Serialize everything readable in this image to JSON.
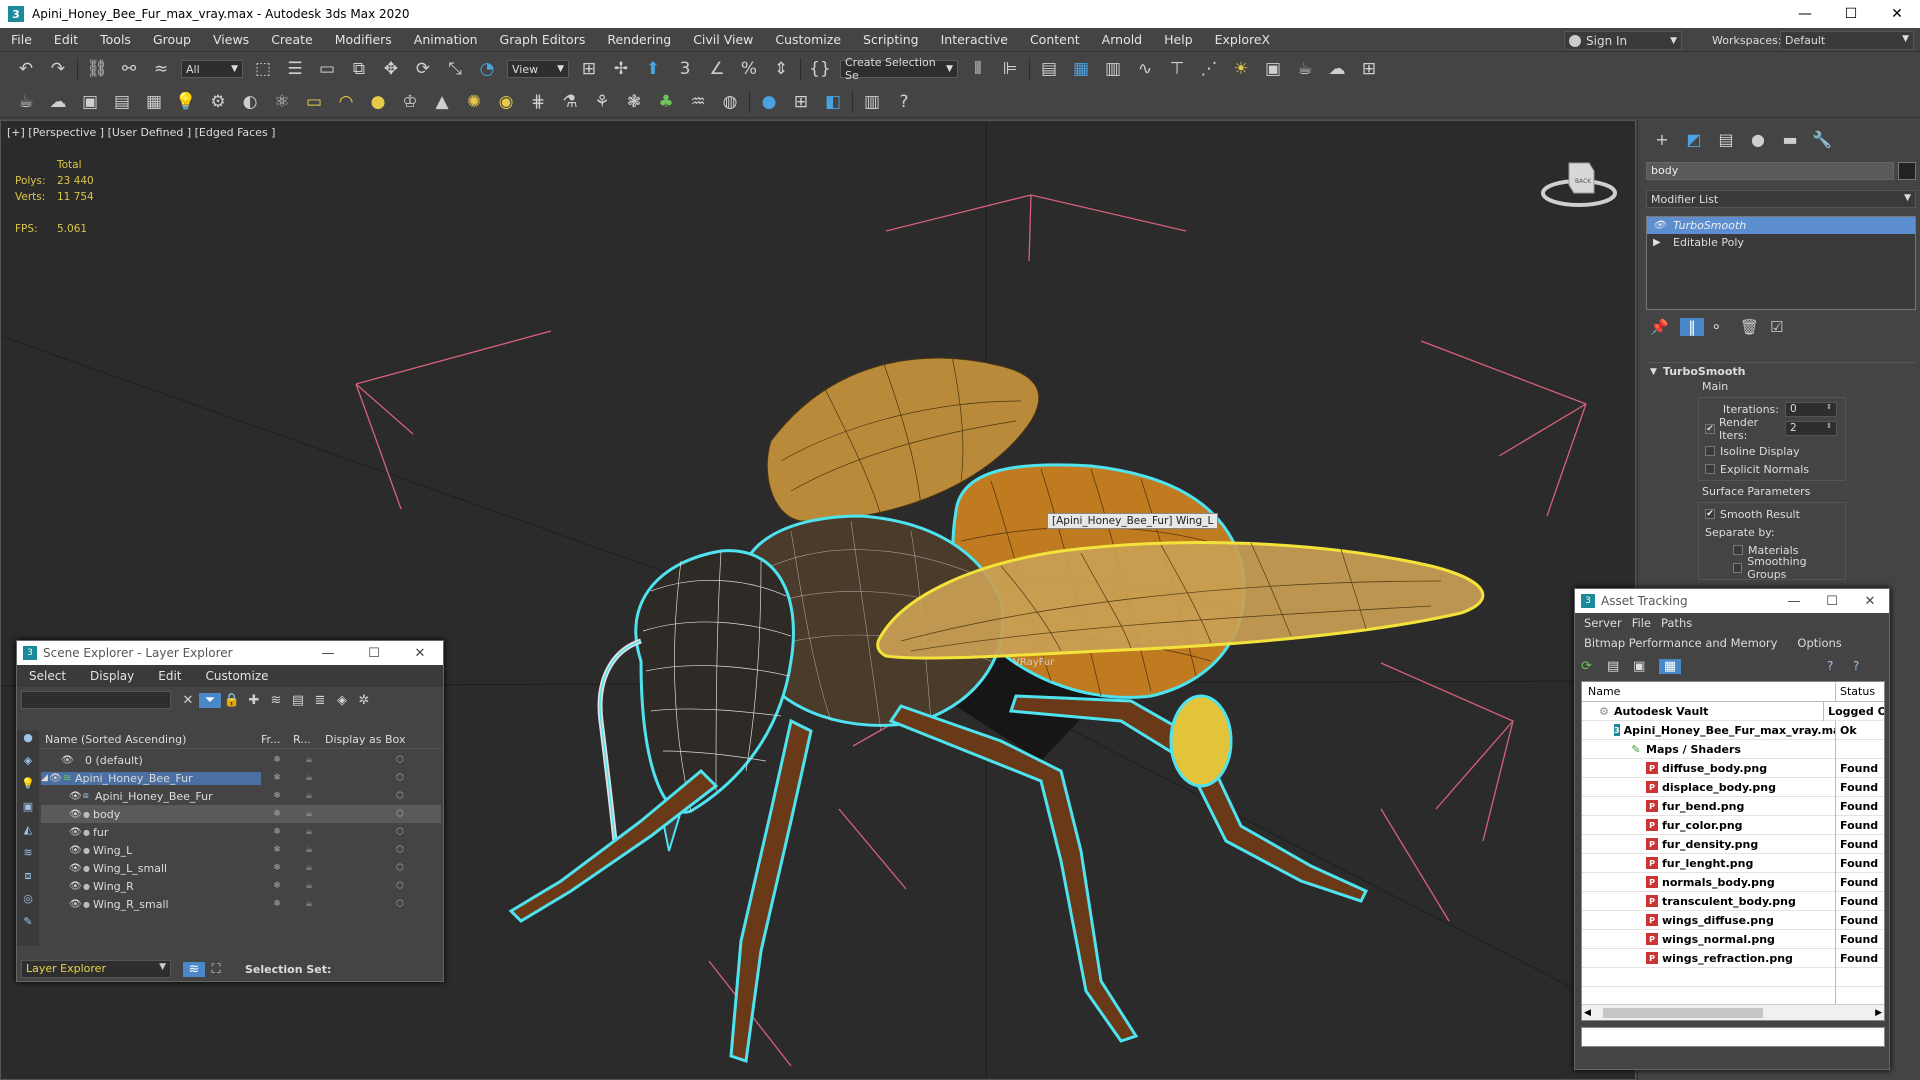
{
  "window": {
    "title": "Apini_Honey_Bee_Fur_max_vray.max - Autodesk 3ds Max 2020",
    "app_icon": "3",
    "minimize": "—",
    "maximize": "☐",
    "close": "✕"
  },
  "menubar": [
    "File",
    "Edit",
    "Tools",
    "Group",
    "Views",
    "Create",
    "Modifiers",
    "Animation",
    "Graph Editors",
    "Rendering",
    "Civil View",
    "Customize",
    "Scripting",
    "Interactive",
    "Content",
    "Arnold",
    "Help",
    "ExploreX"
  ],
  "signin": {
    "label": "Sign In"
  },
  "workspaces": {
    "label": "Workspaces:",
    "value": "Default"
  },
  "toolbar1": {
    "selection_filter": "All",
    "ref_coord": "View",
    "named_selection": "Create Selection Se"
  },
  "viewport": {
    "label": "[+] [Perspective ] [User Defined ] [Edged Faces ]",
    "stats": {
      "total_label": "Total",
      "polys_label": "Polys:",
      "polys_value": "23 440",
      "verts_label": "Verts:",
      "verts_value": "11 754",
      "fps_label": "FPS:",
      "fps_value": "5.061"
    },
    "tooltip": "[Apini_Honey_Bee_Fur] Wing_L",
    "vrayfur_label": "VRayFur",
    "viewcube_label": "BACK"
  },
  "command_panel": {
    "tabs": [
      "create-icon",
      "modify-icon",
      "hierarchy-icon",
      "motion-icon",
      "display-icon",
      "utilities-icon"
    ],
    "object_name": "body",
    "modifier_list": "Modifier List",
    "stack": [
      {
        "label": "TurboSmooth",
        "selected": true
      },
      {
        "label": "Editable Poly",
        "selected": false
      }
    ],
    "turbosmooth": {
      "title": "TurboSmooth",
      "main_label": "Main",
      "iterations_label": "Iterations:",
      "iterations_value": "0",
      "render_iters_label": "Render Iters:",
      "render_iters_value": "2",
      "isoline_display": "Isoline Display",
      "explicit_normals": "Explicit Normals",
      "surface_params": "Surface Parameters",
      "smooth_result": "Smooth Result",
      "separate_by": "Separate by:",
      "materials": "Materials",
      "smoothing_groups": "Smoothing Groups"
    }
  },
  "scene_explorer": {
    "title": "Scene Explorer - Layer Explorer",
    "menu": [
      "Select",
      "Display",
      "Edit",
      "Customize"
    ],
    "columns": [
      "Name (Sorted Ascending)",
      "Fr...",
      "R...",
      "Display as Box"
    ],
    "rows": [
      {
        "label": "0 (default)",
        "indent": 1,
        "selected": false
      },
      {
        "label": "Apini_Honey_Bee_Fur",
        "indent": 0,
        "selected": false,
        "highlight": true,
        "expanded": true
      },
      {
        "label": "Apini_Honey_Bee_Fur",
        "indent": 2,
        "selected": false
      },
      {
        "label": "body",
        "indent": 2,
        "selected": true
      },
      {
        "label": "fur",
        "indent": 2,
        "selected": false
      },
      {
        "label": "Wing_L",
        "indent": 2,
        "selected": false
      },
      {
        "label": "Wing_L_small",
        "indent": 2,
        "selected": false
      },
      {
        "label": "Wing_R",
        "indent": 2,
        "selected": false
      },
      {
        "label": "Wing_R_small",
        "indent": 2,
        "selected": false
      }
    ],
    "bottom": {
      "layer_dropdown": "Layer Explorer",
      "selection_set": "Selection Set:"
    }
  },
  "asset_tracking": {
    "title": "Asset Tracking",
    "menu1": [
      "Server",
      "File",
      "Paths"
    ],
    "menu2": [
      "Bitmap Performance and Memory",
      "Options"
    ],
    "columns": {
      "name": "Name",
      "status": "Status"
    },
    "rows": [
      {
        "label": "Autodesk Vault",
        "status": "Logged O",
        "icon": "vault",
        "indent": 16
      },
      {
        "label": "Apini_Honey_Bee_Fur_max_vray.max",
        "status": "Ok",
        "icon": "max",
        "indent": 32
      },
      {
        "label": "Maps / Shaders",
        "status": "",
        "icon": "maps",
        "indent": 48
      },
      {
        "label": "diffuse_body.png",
        "status": "Found",
        "icon": "png",
        "indent": 64
      },
      {
        "label": "displace_body.png",
        "status": "Found",
        "icon": "png",
        "indent": 64
      },
      {
        "label": "fur_bend.png",
        "status": "Found",
        "icon": "png",
        "indent": 64
      },
      {
        "label": "fur_color.png",
        "status": "Found",
        "icon": "png",
        "indent": 64
      },
      {
        "label": "fur_density.png",
        "status": "Found",
        "icon": "png",
        "indent": 64
      },
      {
        "label": "fur_lenght.png",
        "status": "Found",
        "icon": "png",
        "indent": 64
      },
      {
        "label": "normals_body.png",
        "status": "Found",
        "icon": "png",
        "indent": 64
      },
      {
        "label": "transculent_body.png",
        "status": "Found",
        "icon": "png",
        "indent": 64
      },
      {
        "label": "wings_diffuse.png",
        "status": "Found",
        "icon": "png",
        "indent": 64
      },
      {
        "label": "wings_normal.png",
        "status": "Found",
        "icon": "png",
        "indent": 64
      },
      {
        "label": "wings_refraction.png",
        "status": "Found",
        "icon": "png",
        "indent": 64
      }
    ]
  },
  "colors": {
    "accent_blue": "#4a87c8",
    "selection_cyan": "#4fe3f0",
    "selection_yellow": "#f2e23a",
    "stats_yellow": "#d8c64a",
    "gizmo_pink": "#d9607a"
  }
}
